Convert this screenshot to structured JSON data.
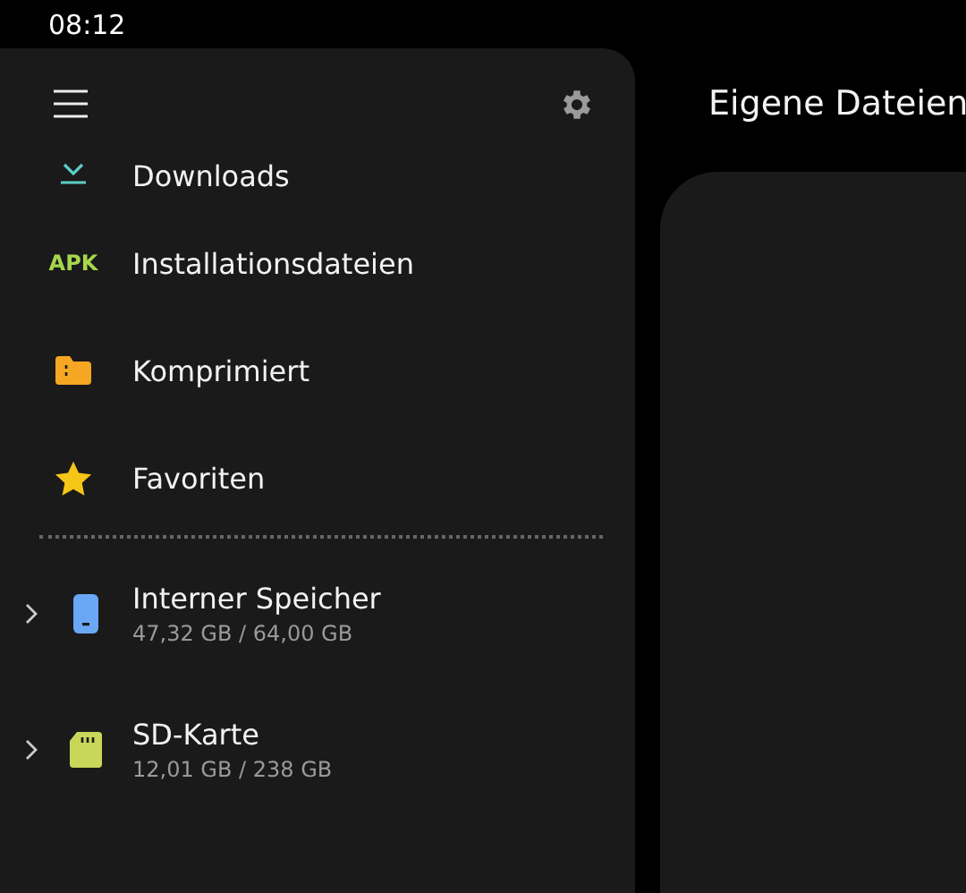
{
  "status_bar": {
    "time": "08:12"
  },
  "drawer": {
    "categories": [
      {
        "kind": "download",
        "label": "Downloads"
      },
      {
        "kind": "apk",
        "icon_text": "APK",
        "label": "Installationsdateien"
      },
      {
        "kind": "archive",
        "label": "Komprimiert"
      },
      {
        "kind": "star",
        "label": "Favoriten"
      }
    ],
    "storage": [
      {
        "kind": "phone",
        "label": "Interner Speicher",
        "usage": "47,32 GB / 64,00 GB",
        "expanded": false
      },
      {
        "kind": "sdcard",
        "label": "SD-Karte",
        "usage": "12,01 GB / 238 GB",
        "expanded": false
      }
    ]
  },
  "main": {
    "title": "Eigene Dateien"
  }
}
